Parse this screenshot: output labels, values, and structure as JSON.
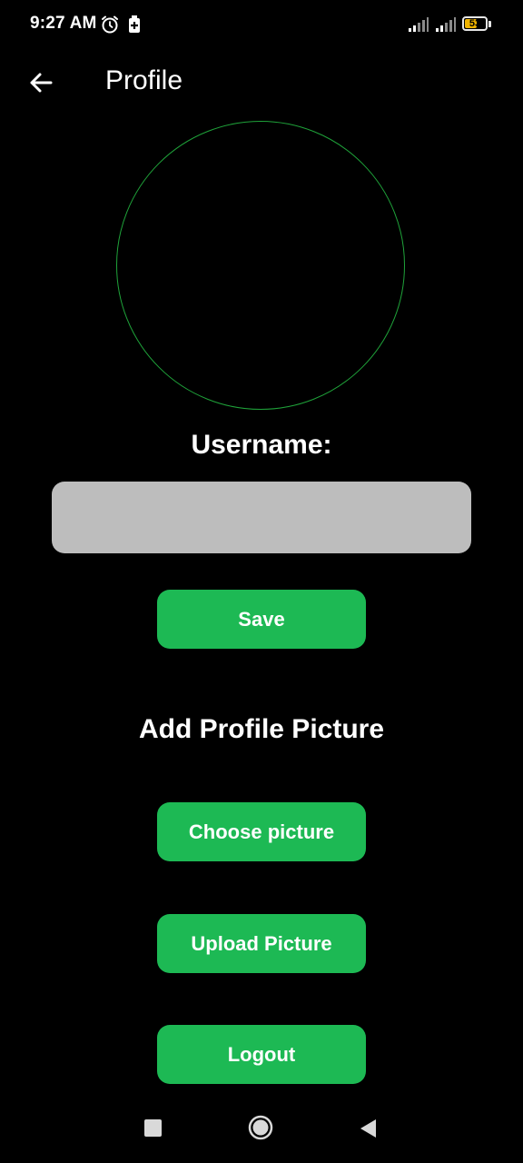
{
  "status_bar": {
    "time": "9:27 AM",
    "battery_level": "53",
    "icons": [
      "alarm-icon",
      "battery-saver-icon",
      "signal-icon",
      "signal-icon",
      "battery-icon"
    ]
  },
  "app_bar": {
    "title": "Profile",
    "back_icon": "arrow-left-icon"
  },
  "profile": {
    "username_label": "Username:",
    "username_value": "",
    "save_label": "Save",
    "add_picture_heading": "Add Profile Picture",
    "choose_picture_label": "Choose picture",
    "upload_picture_label": "Upload Picture",
    "logout_label": "Logout"
  },
  "colors": {
    "background": "#000000",
    "accent": "#1db954",
    "avatar_border": "#1fa33a",
    "input_background": "#bdbdbd"
  },
  "nav_bar": {
    "icons": [
      "recents-icon",
      "home-icon",
      "back-triangle-icon"
    ]
  }
}
